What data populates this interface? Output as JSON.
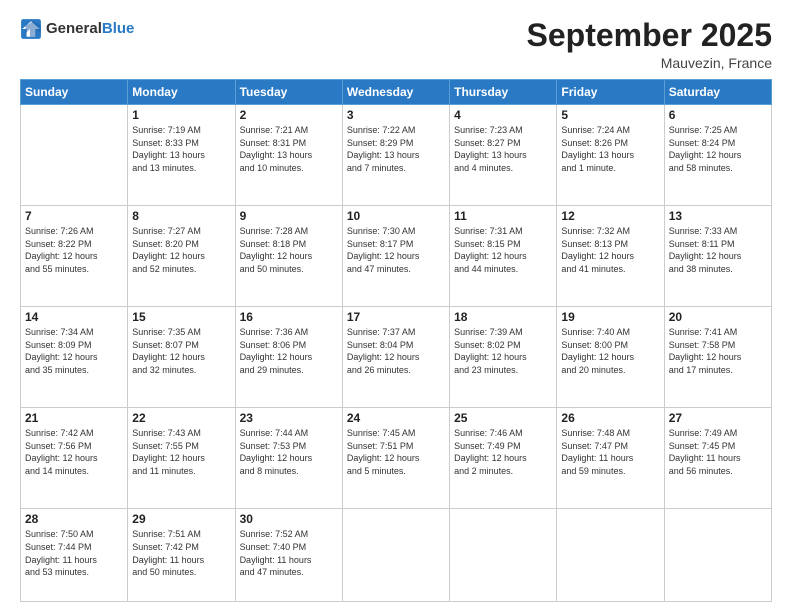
{
  "header": {
    "logo_general": "General",
    "logo_blue": "Blue",
    "month_title": "September 2025",
    "location": "Mauvezin, France"
  },
  "days_of_week": [
    "Sunday",
    "Monday",
    "Tuesday",
    "Wednesday",
    "Thursday",
    "Friday",
    "Saturday"
  ],
  "weeks": [
    [
      {
        "day": "",
        "info": ""
      },
      {
        "day": "1",
        "info": "Sunrise: 7:19 AM\nSunset: 8:33 PM\nDaylight: 13 hours\nand 13 minutes."
      },
      {
        "day": "2",
        "info": "Sunrise: 7:21 AM\nSunset: 8:31 PM\nDaylight: 13 hours\nand 10 minutes."
      },
      {
        "day": "3",
        "info": "Sunrise: 7:22 AM\nSunset: 8:29 PM\nDaylight: 13 hours\nand 7 minutes."
      },
      {
        "day": "4",
        "info": "Sunrise: 7:23 AM\nSunset: 8:27 PM\nDaylight: 13 hours\nand 4 minutes."
      },
      {
        "day": "5",
        "info": "Sunrise: 7:24 AM\nSunset: 8:26 PM\nDaylight: 13 hours\nand 1 minute."
      },
      {
        "day": "6",
        "info": "Sunrise: 7:25 AM\nSunset: 8:24 PM\nDaylight: 12 hours\nand 58 minutes."
      }
    ],
    [
      {
        "day": "7",
        "info": "Sunrise: 7:26 AM\nSunset: 8:22 PM\nDaylight: 12 hours\nand 55 minutes."
      },
      {
        "day": "8",
        "info": "Sunrise: 7:27 AM\nSunset: 8:20 PM\nDaylight: 12 hours\nand 52 minutes."
      },
      {
        "day": "9",
        "info": "Sunrise: 7:28 AM\nSunset: 8:18 PM\nDaylight: 12 hours\nand 50 minutes."
      },
      {
        "day": "10",
        "info": "Sunrise: 7:30 AM\nSunset: 8:17 PM\nDaylight: 12 hours\nand 47 minutes."
      },
      {
        "day": "11",
        "info": "Sunrise: 7:31 AM\nSunset: 8:15 PM\nDaylight: 12 hours\nand 44 minutes."
      },
      {
        "day": "12",
        "info": "Sunrise: 7:32 AM\nSunset: 8:13 PM\nDaylight: 12 hours\nand 41 minutes."
      },
      {
        "day": "13",
        "info": "Sunrise: 7:33 AM\nSunset: 8:11 PM\nDaylight: 12 hours\nand 38 minutes."
      }
    ],
    [
      {
        "day": "14",
        "info": "Sunrise: 7:34 AM\nSunset: 8:09 PM\nDaylight: 12 hours\nand 35 minutes."
      },
      {
        "day": "15",
        "info": "Sunrise: 7:35 AM\nSunset: 8:07 PM\nDaylight: 12 hours\nand 32 minutes."
      },
      {
        "day": "16",
        "info": "Sunrise: 7:36 AM\nSunset: 8:06 PM\nDaylight: 12 hours\nand 29 minutes."
      },
      {
        "day": "17",
        "info": "Sunrise: 7:37 AM\nSunset: 8:04 PM\nDaylight: 12 hours\nand 26 minutes."
      },
      {
        "day": "18",
        "info": "Sunrise: 7:39 AM\nSunset: 8:02 PM\nDaylight: 12 hours\nand 23 minutes."
      },
      {
        "day": "19",
        "info": "Sunrise: 7:40 AM\nSunset: 8:00 PM\nDaylight: 12 hours\nand 20 minutes."
      },
      {
        "day": "20",
        "info": "Sunrise: 7:41 AM\nSunset: 7:58 PM\nDaylight: 12 hours\nand 17 minutes."
      }
    ],
    [
      {
        "day": "21",
        "info": "Sunrise: 7:42 AM\nSunset: 7:56 PM\nDaylight: 12 hours\nand 14 minutes."
      },
      {
        "day": "22",
        "info": "Sunrise: 7:43 AM\nSunset: 7:55 PM\nDaylight: 12 hours\nand 11 minutes."
      },
      {
        "day": "23",
        "info": "Sunrise: 7:44 AM\nSunset: 7:53 PM\nDaylight: 12 hours\nand 8 minutes."
      },
      {
        "day": "24",
        "info": "Sunrise: 7:45 AM\nSunset: 7:51 PM\nDaylight: 12 hours\nand 5 minutes."
      },
      {
        "day": "25",
        "info": "Sunrise: 7:46 AM\nSunset: 7:49 PM\nDaylight: 12 hours\nand 2 minutes."
      },
      {
        "day": "26",
        "info": "Sunrise: 7:48 AM\nSunset: 7:47 PM\nDaylight: 11 hours\nand 59 minutes."
      },
      {
        "day": "27",
        "info": "Sunrise: 7:49 AM\nSunset: 7:45 PM\nDaylight: 11 hours\nand 56 minutes."
      }
    ],
    [
      {
        "day": "28",
        "info": "Sunrise: 7:50 AM\nSunset: 7:44 PM\nDaylight: 11 hours\nand 53 minutes."
      },
      {
        "day": "29",
        "info": "Sunrise: 7:51 AM\nSunset: 7:42 PM\nDaylight: 11 hours\nand 50 minutes."
      },
      {
        "day": "30",
        "info": "Sunrise: 7:52 AM\nSunset: 7:40 PM\nDaylight: 11 hours\nand 47 minutes."
      },
      {
        "day": "",
        "info": ""
      },
      {
        "day": "",
        "info": ""
      },
      {
        "day": "",
        "info": ""
      },
      {
        "day": "",
        "info": ""
      }
    ]
  ]
}
